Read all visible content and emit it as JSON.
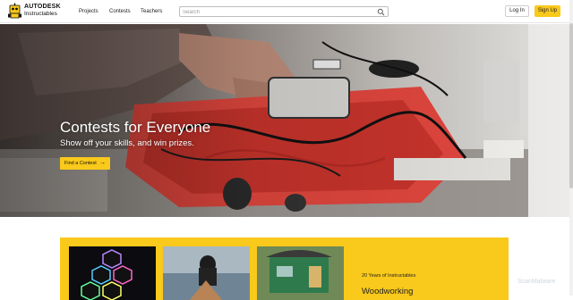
{
  "header": {
    "logo_line1": "AUTODESK",
    "logo_line2": "Instructables",
    "nav": [
      "Projects",
      "Contests",
      "Teachers"
    ],
    "search_placeholder": "Search",
    "login_label": "Log In",
    "signup_label": "Sign Up"
  },
  "hero": {
    "title": "Contests for Everyone",
    "subtitle": "Show off your skills, and win prizes.",
    "cta_label": "Find a Contest",
    "cta_icon": "arrow-right-icon"
  },
  "feature": {
    "kicker": "20 Years of Instructables",
    "title": "Woodworking"
  },
  "watermark": "ScanMalware",
  "colors": {
    "accent": "#f9c91b",
    "text": "#222222",
    "hero_text": "#ffffff"
  }
}
